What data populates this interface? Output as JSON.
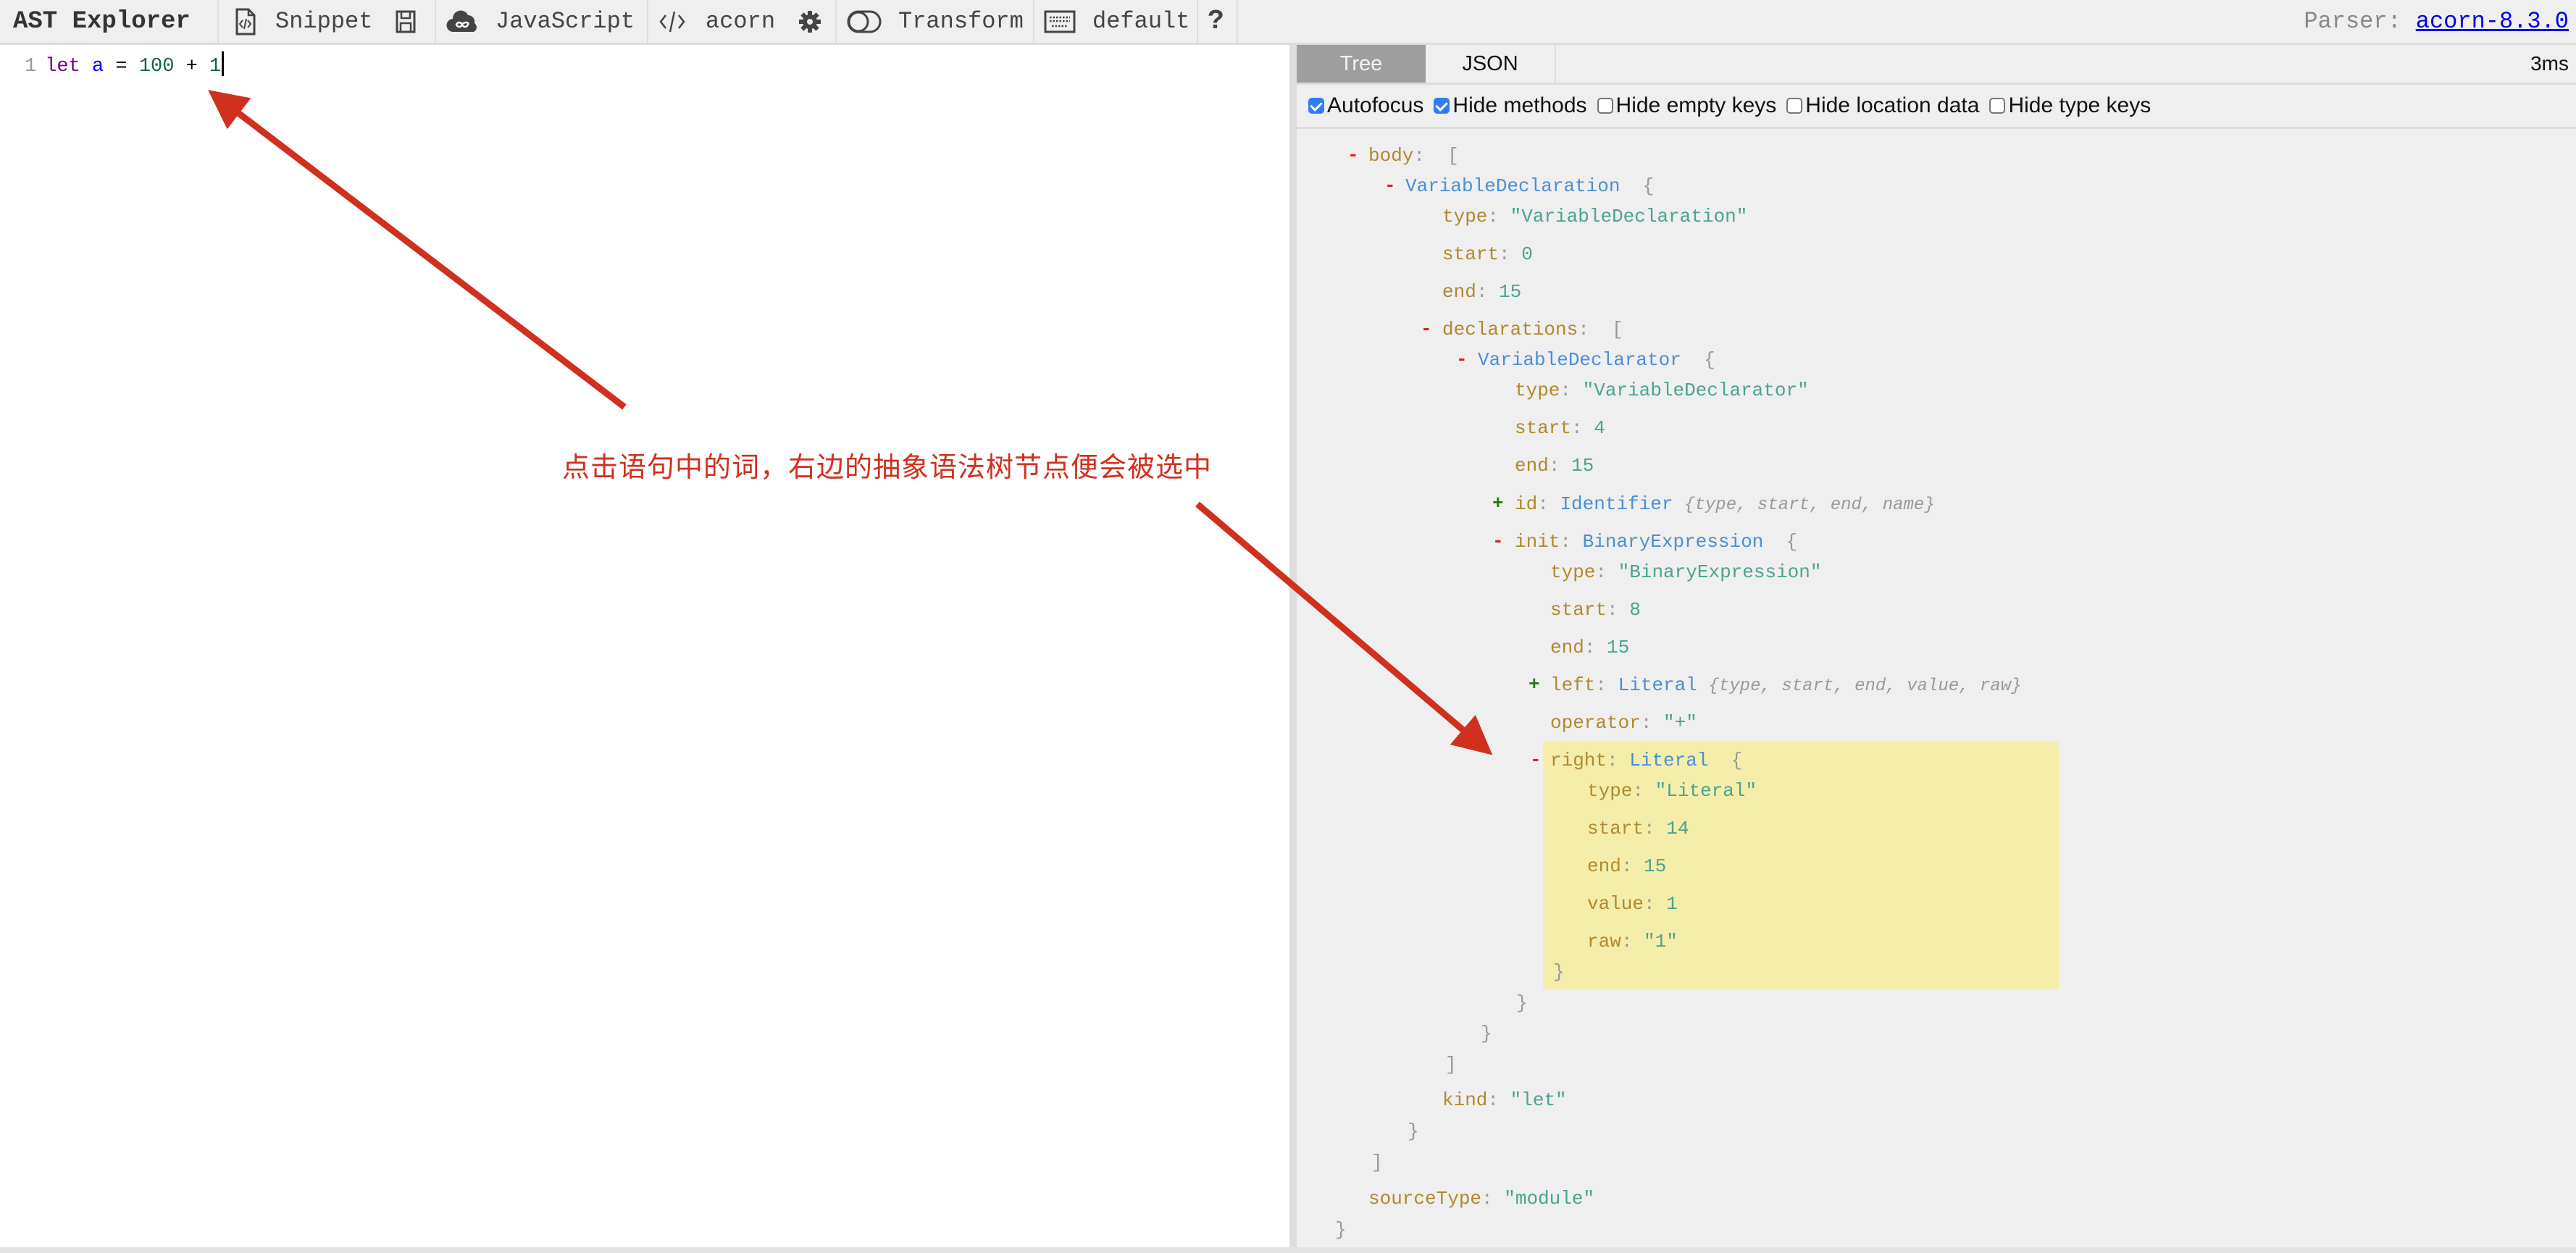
{
  "toolbar": {
    "app_title": "AST Explorer",
    "items": [
      {
        "icon": "file-code-icon",
        "label": "Snippet"
      },
      {
        "icon": "save-icon",
        "label": ""
      },
      {
        "icon": "cloud-language-icon",
        "label": "JavaScript"
      },
      {
        "icon": "code-brackets-icon",
        "label": "acorn"
      },
      {
        "icon": "gear-icon",
        "label": ""
      },
      {
        "icon": "toggle-icon",
        "label": "Transform"
      },
      {
        "icon": "keyboard-icon",
        "label": "default"
      },
      {
        "icon": "help-icon",
        "label": "?"
      }
    ],
    "parser_label": "Parser:",
    "parser_link": "acorn-8.3.0"
  },
  "editor": {
    "line_number": "1",
    "tokens": {
      "keyword": "let",
      "variable": "a",
      "assign": "=",
      "num1": "100",
      "plus": "+",
      "num2": "1"
    }
  },
  "output": {
    "tabs": [
      {
        "label": "Tree",
        "active": true
      },
      {
        "label": "JSON",
        "active": false
      }
    ],
    "timing": "3ms",
    "options": [
      {
        "label": "Autofocus",
        "checked": true
      },
      {
        "label": "Hide methods",
        "checked": true
      },
      {
        "label": "Hide empty keys",
        "checked": false
      },
      {
        "label": "Hide location data",
        "checked": false
      },
      {
        "label": "Hide type keys",
        "checked": false
      }
    ]
  },
  "tree": {
    "body_key": "body",
    "vdecl_type": "VariableDeclaration",
    "vdecl_type_val": "\"VariableDeclaration\"",
    "vdecl_start": "0",
    "vdecl_end": "15",
    "declarations_key": "declarations",
    "vdeclarator_type": "VariableDeclarator",
    "vdeclarator_type_val": "\"VariableDeclarator\"",
    "vdeclarator_start": "4",
    "vdeclarator_end": "15",
    "id_key": "id",
    "id_type": "Identifier",
    "id_summary": "{type, start, end, name}",
    "init_key": "init",
    "init_type": "BinaryExpression",
    "init_type_val": "\"BinaryExpression\"",
    "init_start": "8",
    "init_end": "15",
    "left_key": "left",
    "left_type": "Literal",
    "left_summary": "{type, start, end, value, raw}",
    "operator_key": "operator",
    "operator_val": "\"+\"",
    "right_key": "right",
    "right_type": "Literal",
    "right_type_val": "\"Literal\"",
    "right_start": "14",
    "right_end": "15",
    "right_value": "1",
    "right_raw": "\"1\"",
    "kind_key": "kind",
    "kind_val": "\"let\"",
    "sourceType_key": "sourceType",
    "sourceType_val": "\"module\"",
    "labels": {
      "type": "type",
      "start": "start",
      "end": "end",
      "value": "value",
      "raw": "raw"
    },
    "highlight_color": "#f5eeab"
  },
  "annotation": {
    "text": "点击语句中的词，右边的抽象语法树节点便会被选中",
    "color": "#d0301e"
  }
}
